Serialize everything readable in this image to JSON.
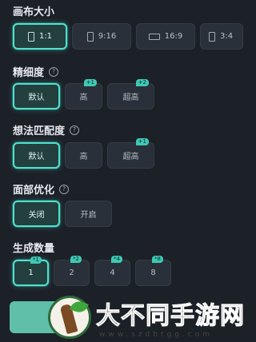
{
  "canvas_size": {
    "title": "画布大小",
    "options": [
      {
        "label": "1:1",
        "icon": "square-ratio-icon",
        "selected": true
      },
      {
        "label": "9:16",
        "icon": "portrait-ratio-icon",
        "selected": false
      },
      {
        "label": "16:9",
        "icon": "landscape-ratio-icon",
        "selected": false
      },
      {
        "label": "3:4",
        "icon": "portrait-ratio-icon",
        "selected": false
      }
    ]
  },
  "detail": {
    "title": "精细度",
    "help": "?",
    "options": [
      {
        "label": "默认",
        "badge": "",
        "selected": true
      },
      {
        "label": "高",
        "badge": "+1",
        "selected": false
      },
      {
        "label": "超高",
        "badge": "+2",
        "selected": false
      }
    ]
  },
  "idea_match": {
    "title": "想法匹配度",
    "help": "?",
    "options": [
      {
        "label": "默认",
        "badge": "",
        "selected": true
      },
      {
        "label": "高",
        "badge": "",
        "selected": false
      },
      {
        "label": "超高",
        "badge": "+1",
        "selected": false
      }
    ]
  },
  "face_opt": {
    "title": "面部优化",
    "help": "?",
    "options": [
      {
        "label": "关闭",
        "selected": true
      },
      {
        "label": "开启",
        "selected": false
      }
    ]
  },
  "count": {
    "title": "生成数量",
    "options": [
      {
        "label": "1",
        "badge": "*1",
        "selected": true
      },
      {
        "label": "2",
        "badge": "*2",
        "selected": false
      },
      {
        "label": "4",
        "badge": "*4",
        "selected": false
      },
      {
        "label": "8",
        "badge": "*8",
        "selected": false
      }
    ]
  },
  "watermark": {
    "text": "大不同手游网",
    "url": "www.szdbtgg.com"
  },
  "colors": {
    "accent": "#4fe0cf",
    "background": "#1c2027",
    "option_bg": "#2a3039",
    "generate_button": "#5fbfa9"
  }
}
